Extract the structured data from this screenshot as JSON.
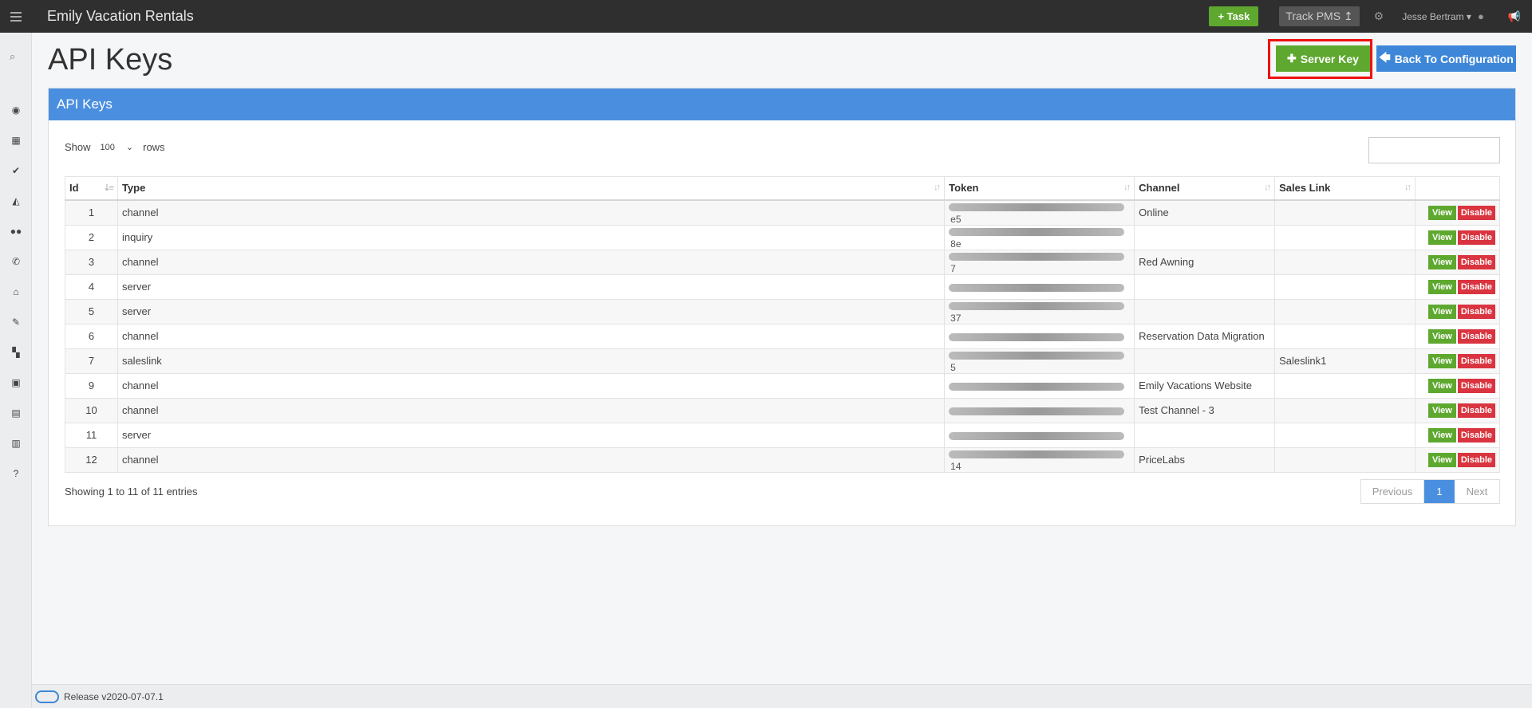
{
  "app": {
    "title": "Emily Vacation Rentals",
    "task_label": "+ Task",
    "track_label": "Track PMS ↥",
    "user_name": "Jesse Bertram ▾"
  },
  "page": {
    "title": "API Keys",
    "server_key_label": "Server Key",
    "back_label": "Back To Configuration"
  },
  "panel": {
    "title": "API Keys",
    "show_label": "Show",
    "rows_label": "rows",
    "rows_value": "100"
  },
  "table": {
    "headers": [
      "Id",
      "Type",
      "Token",
      "Channel",
      "Sales Link"
    ],
    "view_label": "View",
    "disable_label": "Disable",
    "rows": [
      {
        "id": "1",
        "type": "channel",
        "token_tail": "e5",
        "channel": "Online",
        "sales_link": ""
      },
      {
        "id": "2",
        "type": "inquiry",
        "token_tail": "8e",
        "channel": "",
        "sales_link": ""
      },
      {
        "id": "3",
        "type": "channel",
        "token_tail": "7",
        "channel": "Red Awning",
        "sales_link": ""
      },
      {
        "id": "4",
        "type": "server",
        "token_tail": "",
        "channel": "",
        "sales_link": ""
      },
      {
        "id": "5",
        "type": "server",
        "token_tail": "37",
        "channel": "",
        "sales_link": ""
      },
      {
        "id": "6",
        "type": "channel",
        "token_tail": "",
        "channel": "Reservation Data Migration",
        "sales_link": ""
      },
      {
        "id": "7",
        "type": "saleslink",
        "token_tail": "5",
        "channel": "",
        "sales_link": "Saleslink1"
      },
      {
        "id": "9",
        "type": "channel",
        "token_tail": "",
        "channel": "Emily Vacations Website",
        "sales_link": ""
      },
      {
        "id": "10",
        "type": "channel",
        "token_tail": "",
        "channel": "Test Channel - 3",
        "sales_link": ""
      },
      {
        "id": "11",
        "type": "server",
        "token_tail": "",
        "channel": "",
        "sales_link": ""
      },
      {
        "id": "12",
        "type": "channel",
        "token_tail": "14",
        "channel": "PriceLabs",
        "sales_link": ""
      }
    ]
  },
  "footer_info": {
    "showing": "Showing 1 to 11 of 11 entries",
    "prev": "Previous",
    "page": "1",
    "next": "Next"
  },
  "footer": {
    "release": "Release v2020-07-07.1"
  },
  "colors": {
    "green": "#5ea82f",
    "blue": "#4a8fdf",
    "red": "#d9343f",
    "topbar": "#2f2f2f"
  }
}
